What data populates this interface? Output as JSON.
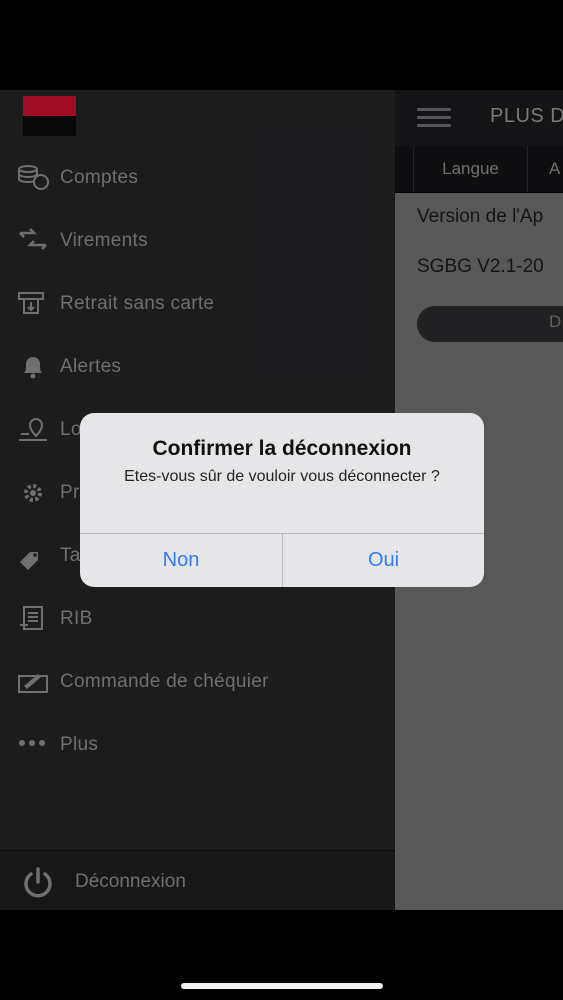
{
  "header": {
    "title": "PLUS D"
  },
  "tabs": [
    {
      "label": "Langue"
    },
    {
      "label": "A"
    }
  ],
  "content": {
    "version_label": "Version de l'Ap",
    "version_value": "SGBG V2.1-20",
    "pill_label": "D"
  },
  "sidebar": {
    "items": [
      {
        "label": "Comptes",
        "icon": "coins-icon"
      },
      {
        "label": "Virements",
        "icon": "transfer-icon"
      },
      {
        "label": "Retrait sans carte",
        "icon": "cash-withdrawal-icon"
      },
      {
        "label": "Alertes",
        "icon": "bell-icon"
      },
      {
        "label": "Lo",
        "icon": "map-pin-icon"
      },
      {
        "label": "Pr",
        "icon": "gear-icon"
      },
      {
        "label": "Ta",
        "icon": "tag-icon"
      },
      {
        "label": "RIB",
        "icon": "document-icon"
      },
      {
        "label": "Commande de chéquier",
        "icon": "checkbook-icon"
      },
      {
        "label": "Plus",
        "icon": "dots-icon"
      }
    ],
    "logout_label": "Déconnexion"
  },
  "dialog": {
    "title": "Confirmer la déconnexion",
    "message": "Etes-vous sûr de vouloir vous déconnecter ?",
    "cancel_label": "Non",
    "confirm_label": "Oui"
  },
  "colors": {
    "brand_red": "#c8102e",
    "ios_blue": "#2f7cf6"
  }
}
